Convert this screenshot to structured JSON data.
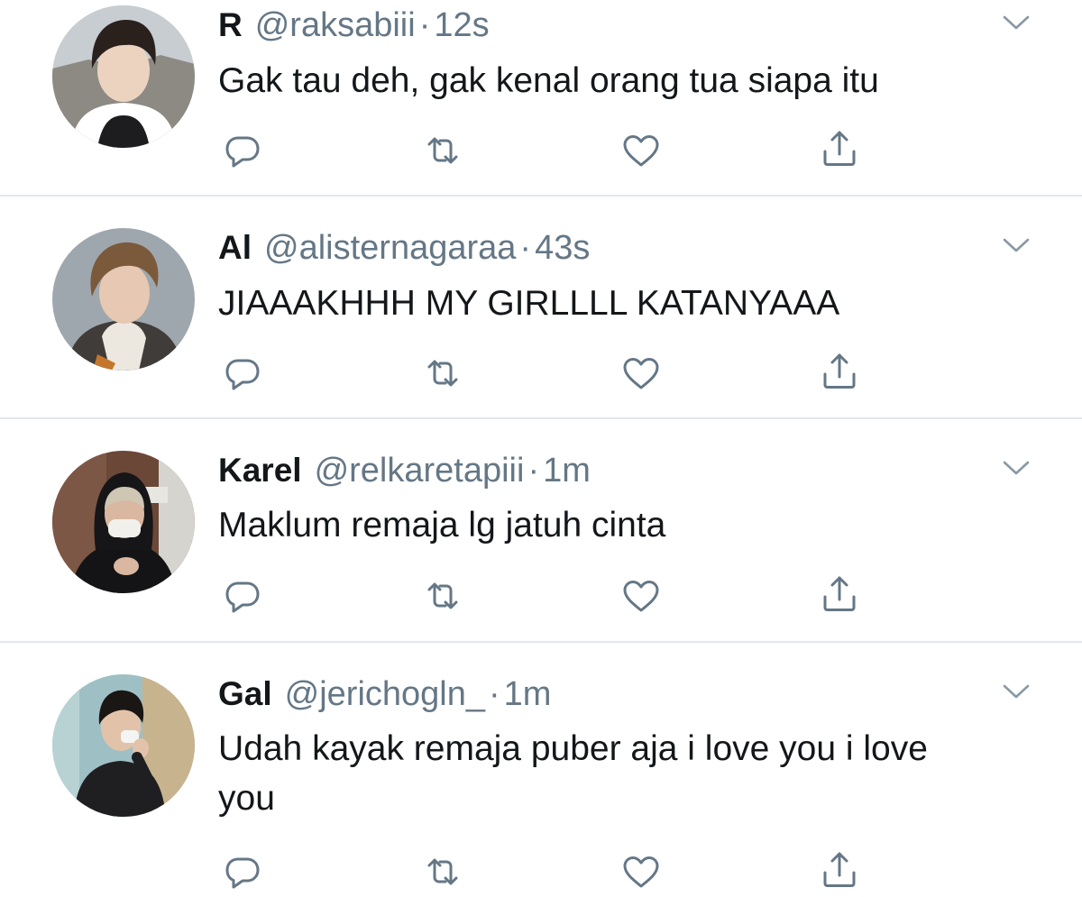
{
  "tweets": [
    {
      "name": "R",
      "handle": "@raksabiii",
      "separator": "·",
      "time": "12s",
      "text": "Gak tau deh, gak kenal orang tua siapa itu"
    },
    {
      "name": "Al",
      "handle": "@alisternagaraa",
      "separator": "·",
      "time": "43s",
      "text": "JIAAAKHHH MY GIRLLLL KATANYAAA"
    },
    {
      "name": "Karel",
      "handle": "@relkaretapiii",
      "separator": "·",
      "time": "1m",
      "text": "Maklum remaja lg jatuh cinta"
    },
    {
      "name": "Gal",
      "handle": "@jerichogln_",
      "separator": "·",
      "time": "1m",
      "text": "Udah kayak remaja puber aja i love you i love you"
    }
  ],
  "icons": {
    "reply": "reply-icon",
    "retweet": "retweet-icon",
    "like": "like-icon",
    "share": "share-icon",
    "caret": "chevron-down-icon"
  },
  "colors": {
    "text_primary": "#14171a",
    "text_secondary": "#657786",
    "divider": "#e1e8ed",
    "icon": "#657786"
  }
}
